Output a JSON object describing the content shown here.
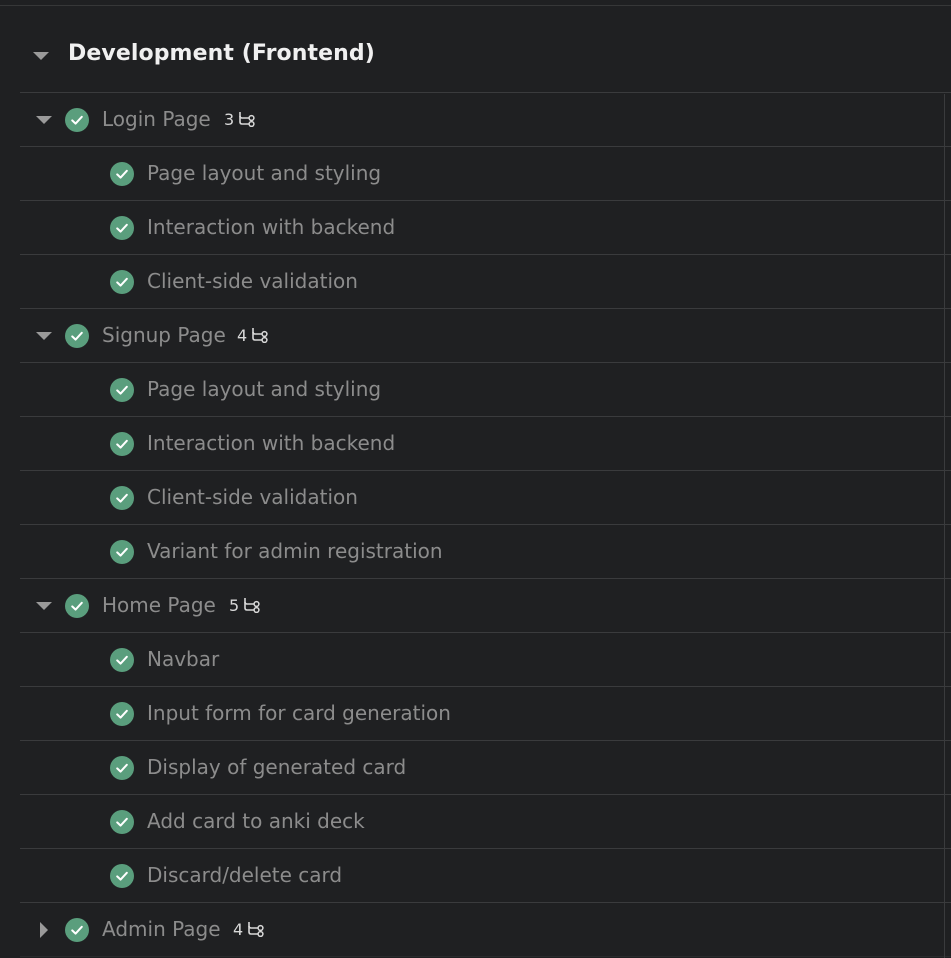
{
  "section": {
    "title": "Development (Frontend)"
  },
  "colors": {
    "background": "#1f2022",
    "check": "#5a9e7d",
    "divider": "#3a3b3d"
  },
  "groups": [
    {
      "label": "Login Page",
      "subtask_count": "3",
      "expanded": true,
      "children": [
        "Page layout and styling",
        "Interaction with backend",
        "Client-side validation"
      ]
    },
    {
      "label": "Signup Page",
      "subtask_count": "4",
      "expanded": true,
      "children": [
        "Page layout and styling",
        "Interaction with backend",
        "Client-side validation",
        "Variant for admin registration"
      ]
    },
    {
      "label": "Home Page",
      "subtask_count": "5",
      "expanded": true,
      "children": [
        "Navbar",
        "Input form for card generation",
        "Display of generated card",
        "Add card to anki deck",
        "Discard/delete card"
      ]
    },
    {
      "label": "Admin Page",
      "subtask_count": "4",
      "expanded": false,
      "children": []
    }
  ]
}
